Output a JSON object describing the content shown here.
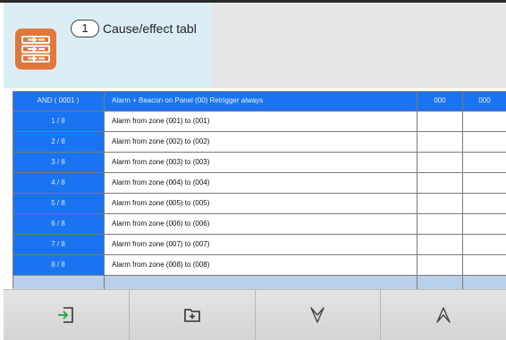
{
  "header": {
    "tab_number": "1",
    "tab_title": "Cause/effect tabl",
    "app_icon": "cause-effect-table-icon",
    "accent_color": "#e2773a"
  },
  "table": {
    "header_row": {
      "label": "AND ( 0001 )",
      "description": "Alarm + Beacon on Panel (00) Retrigger always",
      "v1": "000",
      "v2": "000"
    },
    "rows": [
      {
        "label": "1 / 8",
        "description": "Alarm from zone (001) to (001)"
      },
      {
        "label": "2 / 8",
        "description": "Alarm from zone (002) to (002)"
      },
      {
        "label": "3 / 8",
        "description": "Alarm from zone (003) to (003)"
      },
      {
        "label": "4 / 8",
        "description": "Alarm from zone (004) to (004)"
      },
      {
        "label": "5 / 8",
        "description": "Alarm from zone (005) to (005)"
      },
      {
        "label": "6 / 8",
        "description": "Alarm from zone (006) to (006)"
      },
      {
        "label": "7 / 8",
        "description": "Alarm from zone (007) to (007)"
      },
      {
        "label": "8 / 8",
        "description": "Alarm from zone (008) to (008)"
      }
    ],
    "header_color": "#1a73f0"
  },
  "toolbar": {
    "buttons": [
      {
        "icon": "exit-icon"
      },
      {
        "icon": "add-icon"
      },
      {
        "icon": "chevron-down-icon"
      },
      {
        "icon": "chevron-up-icon"
      }
    ]
  }
}
